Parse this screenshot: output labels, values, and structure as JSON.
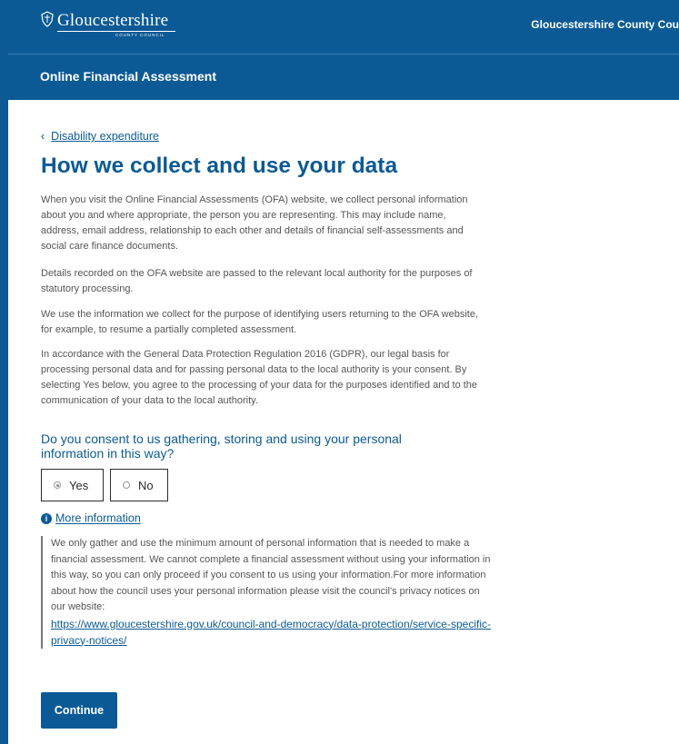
{
  "colors": {
    "brand": "#0b5a96",
    "white": "#ffffff",
    "text": "#555555"
  },
  "header": {
    "logo_name": "Gloucestershire",
    "logo_sub": "COUNTY COUNCIL",
    "right_text": "Gloucestershire County Cou",
    "crest_icon": "crest-icon"
  },
  "subheader": {
    "title": "Online Financial Assessment"
  },
  "back_link": {
    "label": "Disability expenditure",
    "icon": "chevron-left-icon"
  },
  "page_title": "How we collect and use your data",
  "paragraphs": [
    "When you visit the Online Financial Assessments (OFA) website, we collect personal information about you and where appropriate, the person you are representing. This may include name, address, email address, relationship to each other and details of financial self-assessments and social care finance documents.",
    "Details recorded on the OFA website are passed to the relevant local authority for the purposes of statutory processing.",
    "We use the information we collect for the purpose of identifying users returning to the OFA website, for example, to resume a partially completed assessment.",
    "In accordance with the General Data Protection Regulation 2016 (GDPR), our legal basis for processing personal data and for passing personal data to the local authority is your consent. By selecting Yes below, you agree to the processing of your data for the purposes identified and to the communication of your data to the local authority."
  ],
  "question": "Do you consent to us gathering, storing and using your personal information in this way?",
  "options": {
    "yes": "Yes",
    "no": "No",
    "selected": "Yes"
  },
  "more_info": {
    "label": "More information",
    "icon": "info-icon",
    "text": "We only gather and use the minimum amount of personal information that is needed to make a financial assessment. We cannot complete a financial assessment without using your information in this way, so you can only proceed if you consent to us using your information.For more information about how the council uses your personal information please visit the council's privacy notices on our website:",
    "link": "https://www.gloucestershire.gov.uk/council-and-democracy/data-protection/service-specific-privacy-notices/"
  },
  "continue_label": "Continue"
}
